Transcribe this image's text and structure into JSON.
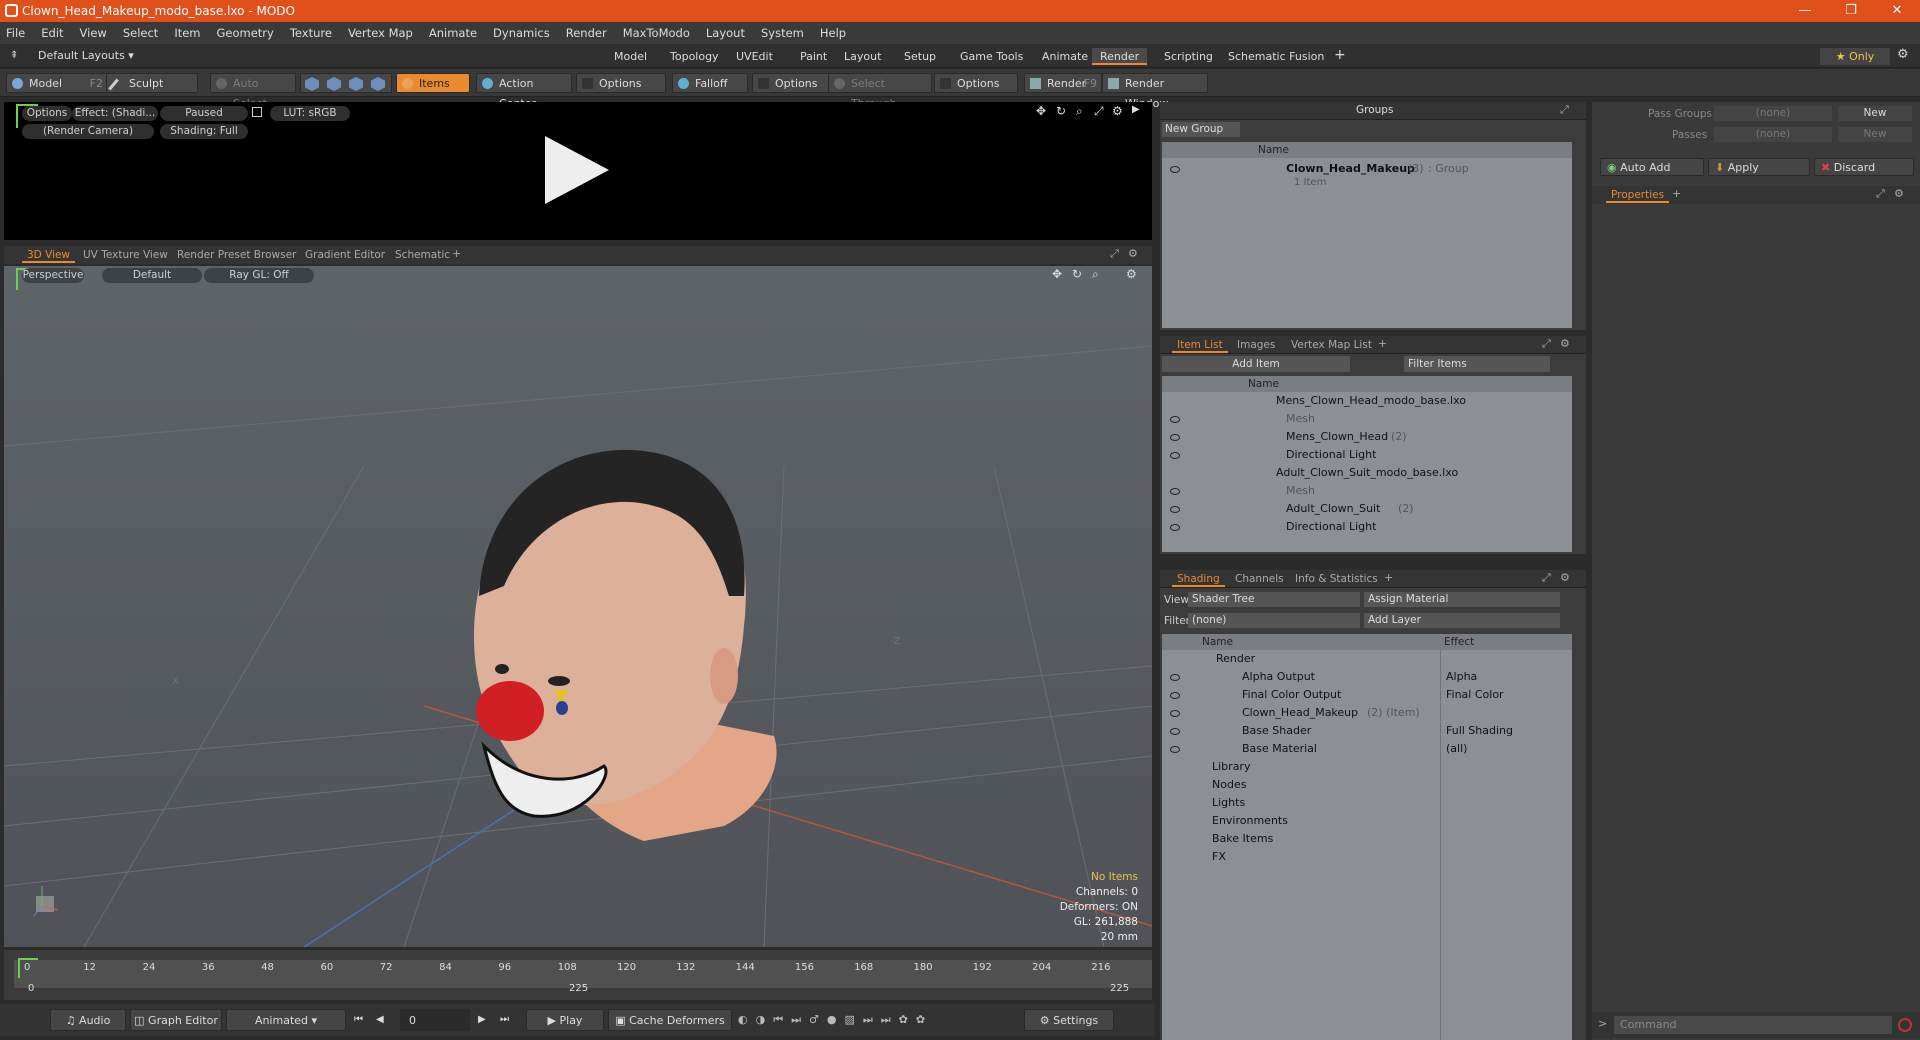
{
  "window": {
    "title": "Clown_Head_Makeup_modo_base.lxo - MODO",
    "controls": [
      "—",
      "❐",
      "✕"
    ]
  },
  "menu": [
    "File",
    "Edit",
    "View",
    "Select",
    "Item",
    "Geometry",
    "Texture",
    "Vertex Map",
    "Animate",
    "Dynamics",
    "Render",
    "MaxToModo",
    "Layout",
    "System",
    "Help"
  ],
  "layouts": {
    "dropdown": "Default Layouts ▾",
    "tabs": [
      "Model",
      "Topology",
      "UVEdit",
      "Paint",
      "Layout",
      "Setup",
      "Game Tools",
      "Animate",
      "Render",
      "Scripting",
      "Schematic Fusion"
    ],
    "active": "Render",
    "plus": "+",
    "only": "★ Only"
  },
  "toolbar": {
    "model": "Model",
    "model_key": "F2",
    "sculpt": "Sculpt",
    "auto_select": "Auto Select",
    "items": "Items",
    "action_center": "Action Center",
    "options1": "Options",
    "falloff": "Falloff",
    "options2": "Options",
    "select_through": "Select Through",
    "options3": "Options",
    "render": "Render",
    "render_key": "F9",
    "render_window": "Render Window"
  },
  "preview": {
    "options": "Options",
    "effect": "Effect: (Shadi...",
    "paused": "Paused",
    "lut": "LUT: sRGB",
    "camera": "(Render Camera)",
    "shading": "Shading: Full"
  },
  "viewport_tabs": [
    "3D View",
    "UV Texture View",
    "Render Preset Browser",
    "Gradient Editor",
    "Schematic"
  ],
  "viewport": {
    "perspective": "Perspective",
    "default": "Default",
    "raygl": "Ray GL: Off",
    "axis_x": "X",
    "axis_z": "-Z",
    "stats": {
      "items": "No Items",
      "channels": "Channels: 0",
      "deformers": "Deformers: ON",
      "gl": "GL: 261,888",
      "size": "20 mm"
    }
  },
  "groups": {
    "title": "Groups",
    "new_group": "New Group",
    "col_name": "Name",
    "item_name": "Clown_Head_Makeup",
    "item_count": "(3)",
    "item_type": ": Group",
    "item_sub": "1 Item"
  },
  "pass": {
    "pass_groups": "Pass Groups",
    "passes": "Passes",
    "none1": "(none)",
    "none2": "(none)",
    "new1": "New",
    "new2": "New",
    "auto_add": "Auto Add",
    "apply": "Apply",
    "discard": "Discard",
    "properties": "Properties"
  },
  "itemlist": {
    "tabs": [
      "Item List",
      "Images",
      "Vertex Map List"
    ],
    "add_item": "Add Item",
    "filter": "Filter Items",
    "col_name": "Name",
    "rows": [
      {
        "label": "Mens_Clown_Head_modo_base.lxo",
        "indent": 0,
        "dim": false
      },
      {
        "label": "Mesh",
        "indent": 1,
        "dim": true
      },
      {
        "label": "Mens_Clown_Head",
        "count": "(2)",
        "indent": 1,
        "dim": false
      },
      {
        "label": "Directional Light",
        "indent": 1,
        "dim": false
      },
      {
        "label": "Adult_Clown_Suit_modo_base.lxo",
        "indent": 0,
        "dim": false
      },
      {
        "label": "Mesh",
        "indent": 1,
        "dim": true
      },
      {
        "label": "Adult_Clown_Suit",
        "count": "(2)",
        "indent": 1,
        "dim": false
      },
      {
        "label": "Directional Light",
        "indent": 1,
        "dim": false
      }
    ]
  },
  "shading": {
    "tabs": [
      "Shading",
      "Channels",
      "Info & Statistics"
    ],
    "view_label": "View",
    "view_value": "Shader Tree",
    "assign": "Assign Material",
    "filter_label": "Filter",
    "filter_value": "(none)",
    "add_layer": "Add Layer",
    "col_name": "Name",
    "col_effect": "Effect",
    "rows": [
      {
        "label": "Render",
        "effect": ""
      },
      {
        "label": "Alpha Output",
        "effect": "Alpha"
      },
      {
        "label": "Final Color Output",
        "effect": "Final Color"
      },
      {
        "label": "Clown_Head_Makeup",
        "extra": "(2) (Item)",
        "effect": ""
      },
      {
        "label": "Base Shader",
        "effect": "Full Shading"
      },
      {
        "label": "Base Material",
        "effect": "(all)"
      },
      {
        "label": "Library",
        "effect": ""
      },
      {
        "label": "Nodes",
        "effect": ""
      },
      {
        "label": "Lights",
        "effect": ""
      },
      {
        "label": "Environments",
        "effect": ""
      },
      {
        "label": "Bake Items",
        "effect": ""
      },
      {
        "label": "FX",
        "effect": ""
      }
    ]
  },
  "timeline": {
    "ticks": [
      "0",
      "12",
      "24",
      "36",
      "48",
      "60",
      "72",
      "84",
      "96",
      "108",
      "120",
      "132",
      "144",
      "156",
      "168",
      "180",
      "192",
      "204",
      "216"
    ],
    "start": "0",
    "mid": "225",
    "end": "225"
  },
  "bottom": {
    "audio": "Audio",
    "graph": "Graph Editor",
    "animated": "Animated",
    "frame": "0",
    "play": "Play",
    "cache": "Cache Deformers",
    "settings": "Settings",
    "command": "Command"
  }
}
